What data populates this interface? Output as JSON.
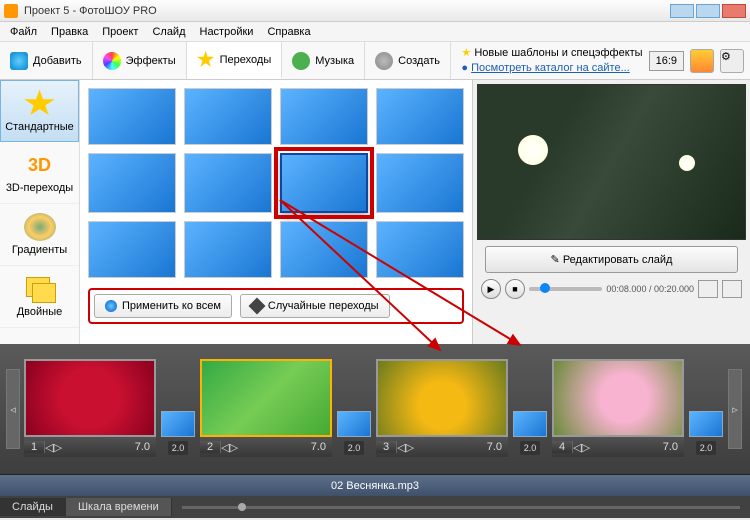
{
  "title": "Проект 5 - ФотоШОУ PRO",
  "menu": [
    "Файл",
    "Правка",
    "Проект",
    "Слайд",
    "Настройки",
    "Справка"
  ],
  "tabs": {
    "add": "Добавить",
    "fx": "Эффекты",
    "trans": "Переходы",
    "music": "Музыка",
    "create": "Создать"
  },
  "hints": {
    "h1": "Новые шаблоны и спецэффекты",
    "h2": "Посмотреть каталог на сайте..."
  },
  "aspect": "16:9",
  "sidebar": {
    "std": "Стандартные",
    "d3": "3D-переходы",
    "grad": "Градиенты",
    "dbl": "Двойные",
    "d3_icon": "3D"
  },
  "actions": {
    "apply": "Применить ко всем",
    "random": "Случайные переходы"
  },
  "preview": {
    "edit": "Редактировать слайд",
    "time": "00:08.000 / 00:20.000",
    "pencil": "✎",
    "play": "▶",
    "stop": "■"
  },
  "timeline": {
    "slides": [
      {
        "n": "1",
        "d": "7.0"
      },
      {
        "n": "2",
        "d": "7.0"
      },
      {
        "n": "3",
        "d": "7.0"
      },
      {
        "n": "4",
        "d": "7.0"
      }
    ],
    "trans_dur": "2.0",
    "audio": "02 Веснянка.mp3",
    "scroll": "▹",
    "scroll_l": "◃",
    "sp": "◁▷"
  },
  "bottom": {
    "slides": "Слайды",
    "scale": "Шкала времени"
  },
  "win": {
    "min": "_",
    "max": "□",
    "close": "×"
  }
}
